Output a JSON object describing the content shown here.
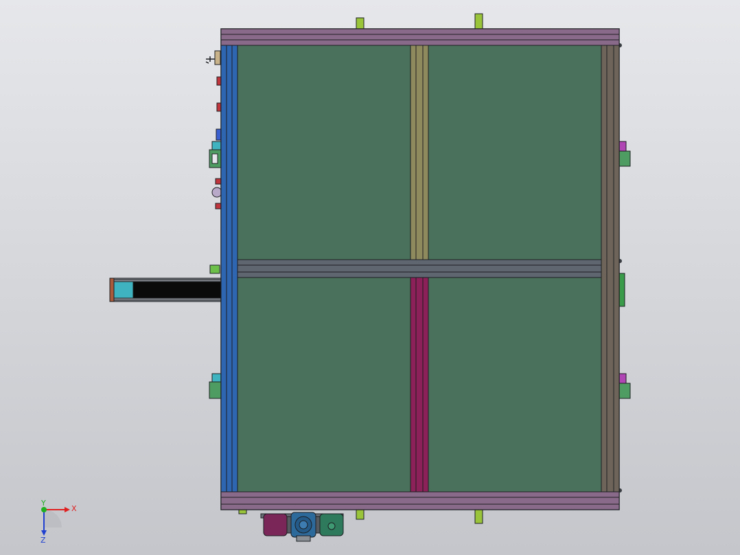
{
  "view": {
    "background_top": "#e6e7ea",
    "background_bottom": "#c4c6cb"
  },
  "colors": {
    "edge": "#1c1f22",
    "panel": "#4a715b",
    "top_rail": "#8a6a8a",
    "bottom_rail": "#8a6a8a",
    "left_rail": "#2f66b2",
    "right_rail": "#6e6459",
    "mid_rail": "#5f6670",
    "divider_upper": "#8f8a5e",
    "divider_lower": "#8c2058",
    "foot": "#9ac43a",
    "cyan_block": "#3fb3bf",
    "magenta_block": "#b046b4",
    "green_bracket": "#4f9c62",
    "red_part": "#c0343c",
    "conveyor_frame": "#a85a3a",
    "motor_magenta": "#7a2658",
    "motor_blue": "#2d6a9c",
    "motor_teal": "#2e7a5c"
  },
  "icons": {
    "triad": "coordinate-triad-icon"
  },
  "triad": {
    "x_label": "X",
    "y_label": "Y",
    "z_label": "Z",
    "x_color": "#e02020",
    "y_color": "#20b020",
    "z_color": "#2040d0"
  }
}
